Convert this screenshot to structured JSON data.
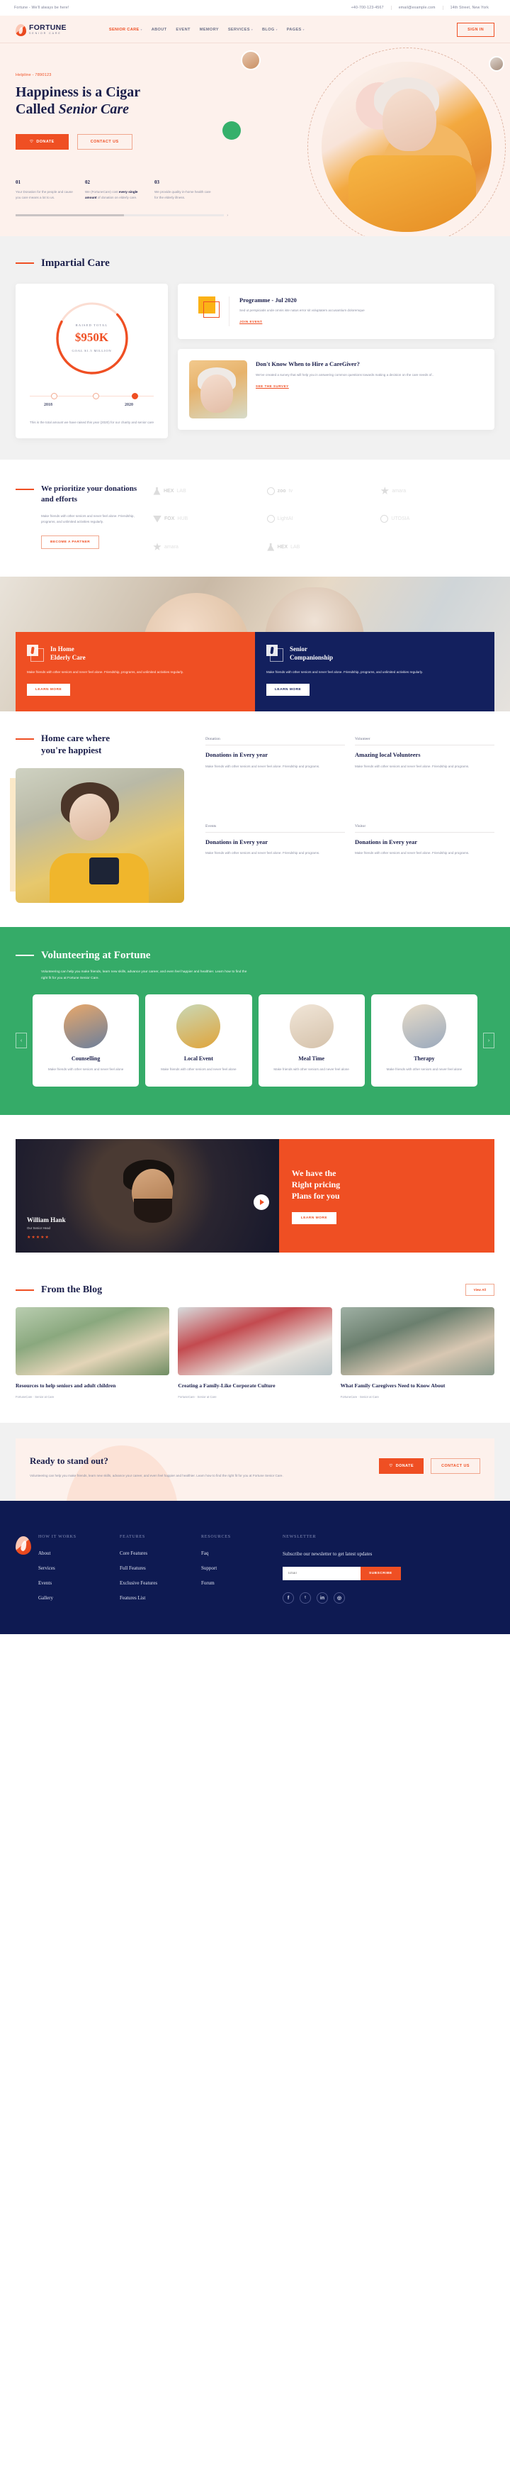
{
  "topbar": {
    "tagline": "Fortune - We'll always be here!",
    "phone": "+40-700-123-4567",
    "email": "email@example.com",
    "address": "14th Street, New York"
  },
  "header": {
    "logo_title": "FORTUNE",
    "logo_sub": "SENIOR CARE",
    "nav": [
      {
        "label": "SENIOR CARE",
        "caret": "▾",
        "active": true
      },
      {
        "label": "ABOUT",
        "caret": "",
        "active": false
      },
      {
        "label": "EVENT",
        "caret": "",
        "active": false
      },
      {
        "label": "MEMORY",
        "caret": "",
        "active": false
      },
      {
        "label": "SERVICES",
        "caret": "▾",
        "active": false
      },
      {
        "label": "BLOG",
        "caret": "▾",
        "active": false
      },
      {
        "label": "PAGES",
        "caret": "▾",
        "active": false
      }
    ],
    "signin": "SIGN IN"
  },
  "hero": {
    "helpline": "Helpline - 7890123",
    "title_line1": "Happiness is a Cigar",
    "title_line2_a": "Called ",
    "title_line2_b": "Senior Care",
    "btn_donate": "DONATE",
    "btn_contact": "CONTACT US",
    "stats": [
      {
        "num": "01",
        "text": "Your Donation for the people and cause you care means a lot to us.",
        "bold": ""
      },
      {
        "num": "02",
        "text_pre": "We (FortuneCare) cost ",
        "bold": "every single amount",
        "text_post": " of donation on elderly care."
      },
      {
        "num": "03",
        "text": "We provide quality in-home health care for the elderly illness."
      }
    ]
  },
  "impartial": {
    "title": "Impartial Care",
    "raised_label": "RAISED TOTAL",
    "raised_amount": "$950K",
    "goal_label": "GOAL $1.5 MILLION",
    "years": [
      "2018",
      "2020"
    ],
    "note": "This is the total amount we have raised this year (2020) for our charity and senior care",
    "programme": {
      "title": "Programme - Jul 2020",
      "desc": "Sed ut perspiciatis unde omnis iste natus error sit voluptatem accusantium doloremque",
      "link": "JOIN EVENT"
    },
    "caregiver": {
      "title": "Don't Know When to Hire a CareGiver?",
      "desc": "We've created a survey that will help you in answering common questions towards making a decision on the care needs of..",
      "link": "SEE THE SURVEY"
    }
  },
  "prioritize": {
    "title": "We prioritize your donations and efforts",
    "desc": "Make friends with other seniors and never feel alone. Friendship, programs, and unlimited activities regularly.",
    "button": "BECOME A PARTNER",
    "partners": [
      {
        "name_bold": "HEX",
        "name_light": "LAB",
        "icon": "flask-icon"
      },
      {
        "name_bold": "zoo",
        "name_light": "tv",
        "icon": "zoo-circle-icon"
      },
      {
        "name_bold": "",
        "name_light": "amara",
        "icon": "amara-star-icon"
      },
      {
        "name_bold": "FOX",
        "name_light": "HUB",
        "icon": "fox-heart-icon"
      },
      {
        "name_bold": "",
        "name_light": "LightAI",
        "icon": "light-circle-icon"
      },
      {
        "name_bold": "",
        "name_light": "UTOSIA",
        "icon": "utosia-circle-icon"
      },
      {
        "name_bold": "",
        "name_light": "amara",
        "icon": "amara-star-icon"
      },
      {
        "name_bold": "HEX",
        "name_light": "LAB",
        "icon": "flask-icon"
      }
    ]
  },
  "banner": {
    "cards": [
      {
        "title_l1": "In Home",
        "title_l2": "Elderly Care",
        "desc": "Make friends with other seniors and never feel alone. Friendship, programs, and unlimited activities regularly.",
        "button": "LEARN MORE"
      },
      {
        "title_l1": "Senior",
        "title_l2": "Companionship",
        "desc": "Make friends with other seniors and never feel alone. Friendship, programs, and unlimited activities regularly.",
        "button": "LEARN MORE"
      }
    ]
  },
  "happy": {
    "title_l1": "Home care where",
    "title_l2": "you're happiest",
    "cells": [
      {
        "tag": "Donation",
        "title": "Donations in Every year",
        "desc": "Make friends with other seniors and never feel alone. Friendship and programs."
      },
      {
        "tag": "Volunteer",
        "title": "Amazing local Volunteers",
        "desc": "Make friends with other seniors and never feel alone. Friendship and programs."
      },
      {
        "tag": "Events",
        "title": "Donations in Every year",
        "desc": "Make friends with other seniors and never feel alone. Friendship and programs."
      },
      {
        "tag": "Visitor",
        "title": "Donations in Every year",
        "desc": "Make friends with other seniors and never feel alone. Friendship and programs."
      }
    ]
  },
  "volunteering": {
    "title": "Volunteering at Fortune",
    "desc": "Volunteering can help you make friends, learn new skills, advance your career, and even feel happier and healthier. Learn how to find the right fit for you at Fortune Senior Care.",
    "prev": "‹",
    "next": "›",
    "cards": [
      {
        "title": "Counselling",
        "desc": "Make friends with other seniors and never feel alone"
      },
      {
        "title": "Local Event",
        "desc": "Make friends with other seniors and never feel alone"
      },
      {
        "title": "Meal Time",
        "desc": "Make friends with other seniors and never feel alone"
      },
      {
        "title": "Therapy",
        "desc": "Make friends with other seniors and never feel alone"
      }
    ]
  },
  "pricing": {
    "name": "William Hank",
    "role": "Our Senior Head",
    "stars": "★★★★★",
    "title_l1": "We have the",
    "title_l2": "Right pricing",
    "title_l3": "Plans for you",
    "button": "LEARN MORE"
  },
  "blog": {
    "title": "From the Blog",
    "view_all": "View All",
    "posts": [
      {
        "title": "Resources to help seniors and adult children",
        "meta": "FortuneCare · Senior at Care"
      },
      {
        "title": "Creating a Family-Like Corporate Culture",
        "meta": "FortuneCare · Senior at Care"
      },
      {
        "title": "What Family Caregivers Need to Know About",
        "meta": "FortuneCare · Senior at Care"
      }
    ]
  },
  "cta": {
    "title": "Ready to stand out?",
    "desc": "Volunteering can help you make friends, learn new skills, advance your career, and even feel happier and healthier. Learn how to find the right fit for you at Fortune Senior Care.",
    "btn_donate": "DONATE",
    "btn_contact": "CONTACT US"
  },
  "footer": {
    "columns": [
      {
        "heading": "HOW IT WORKS",
        "links": [
          "About",
          "Services",
          "Events",
          "Gallery"
        ]
      },
      {
        "heading": "FEATURES",
        "links": [
          "Core Features",
          "Full Features",
          "Exclusive Features",
          "Features List"
        ]
      },
      {
        "heading": "RESOURCES",
        "links": [
          "Faq",
          "Support",
          "Forum"
        ]
      }
    ],
    "newsletter": {
      "heading": "NEWSLETTER",
      "text": "Subscribe our newsletter to get latest updates",
      "placeholder": "Email",
      "button": "SUBSCRIBE"
    },
    "socials": [
      "f",
      "ᵗ",
      "in",
      "◎"
    ]
  },
  "colors": {
    "accent": "#ef4f23",
    "navy": "#13205e",
    "green": "#35ab68",
    "yellow": "#fbb216"
  }
}
